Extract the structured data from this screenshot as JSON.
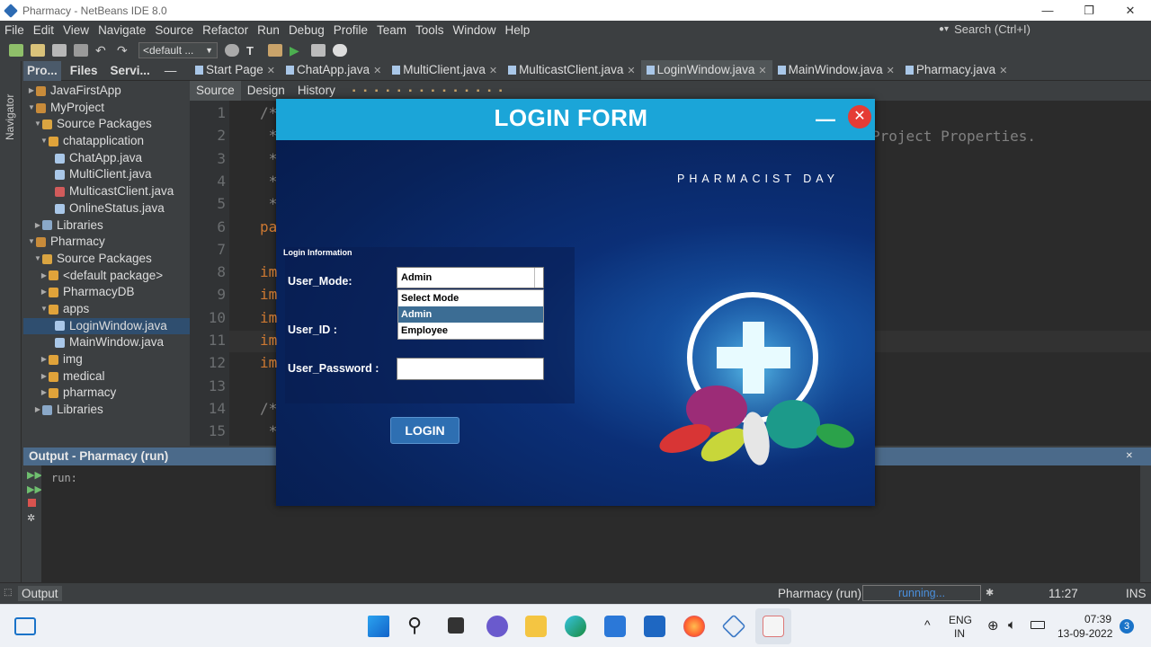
{
  "window": {
    "title": "Pharmacy - NetBeans IDE 8.0",
    "controls": [
      "—",
      "❐",
      "✕"
    ]
  },
  "menu": [
    "File",
    "Edit",
    "View",
    "Navigate",
    "Source",
    "Refactor",
    "Run",
    "Debug",
    "Profile",
    "Team",
    "Tools",
    "Window",
    "Help"
  ],
  "search": {
    "placeholder": "Search (Ctrl+I)"
  },
  "toolbar": {
    "config": "<default ..."
  },
  "navigator": {
    "label": "Navigator"
  },
  "project_panel": {
    "tabs": [
      "Pro...",
      "Files",
      "Servi..."
    ],
    "close": "—",
    "tree": [
      {
        "label": "JavaFirstApp",
        "indent": 0,
        "arrow": "▶",
        "icon": "#c88b3a"
      },
      {
        "label": "MyProject",
        "indent": 0,
        "arrow": "▼",
        "icon": "#c88b3a"
      },
      {
        "label": "Source Packages",
        "indent": 1,
        "arrow": "▼",
        "icon": "#d9a441"
      },
      {
        "label": "chatapplication",
        "indent": 2,
        "arrow": "▼",
        "icon": "#e0a33a"
      },
      {
        "label": "ChatApp.java",
        "indent": 3,
        "arrow": "",
        "icon": "#a9c7e8"
      },
      {
        "label": "MultiClient.java",
        "indent": 3,
        "arrow": "",
        "icon": "#a9c7e8"
      },
      {
        "label": "MulticastClient.java",
        "indent": 3,
        "arrow": "",
        "icon": "#d15b5b"
      },
      {
        "label": "OnlineStatus.java",
        "indent": 3,
        "arrow": "",
        "icon": "#a9c7e8"
      },
      {
        "label": "Libraries",
        "indent": 1,
        "arrow": "▶",
        "icon": "#8aa8c8"
      },
      {
        "label": "Pharmacy",
        "indent": 0,
        "arrow": "▼",
        "icon": "#c88b3a"
      },
      {
        "label": "Source Packages",
        "indent": 1,
        "arrow": "▼",
        "icon": "#d9a441"
      },
      {
        "label": "<default package>",
        "indent": 2,
        "arrow": "▶",
        "icon": "#e0a33a"
      },
      {
        "label": "PharmacyDB",
        "indent": 2,
        "arrow": "▶",
        "icon": "#e0a33a"
      },
      {
        "label": "apps",
        "indent": 2,
        "arrow": "▼",
        "icon": "#e0a33a"
      },
      {
        "label": "LoginWindow.java",
        "indent": 3,
        "arrow": "",
        "icon": "#a9c7e8",
        "selected": true
      },
      {
        "label": "MainWindow.java",
        "indent": 3,
        "arrow": "",
        "icon": "#a9c7e8"
      },
      {
        "label": "img",
        "indent": 2,
        "arrow": "▶",
        "icon": "#e0a33a"
      },
      {
        "label": "medical",
        "indent": 2,
        "arrow": "▶",
        "icon": "#e0a33a"
      },
      {
        "label": "pharmacy",
        "indent": 2,
        "arrow": "▶",
        "icon": "#e0a33a"
      },
      {
        "label": "Libraries",
        "indent": 1,
        "arrow": "▶",
        "icon": "#8aa8c8"
      }
    ]
  },
  "editor_tabs": [
    {
      "label": "Start Page",
      "close": "✕",
      "active": false
    },
    {
      "label": "ChatApp.java",
      "close": "✕",
      "active": false
    },
    {
      "label": "MultiClient.java",
      "close": "✕",
      "active": false
    },
    {
      "label": "MulticastClient.java",
      "close": "✕",
      "active": false
    },
    {
      "label": "LoginWindow.java",
      "close": "✕",
      "active": true
    },
    {
      "label": "MainWindow.java",
      "close": "✕",
      "active": false
    },
    {
      "label": "Pharmacy.java",
      "close": "✕",
      "active": false
    }
  ],
  "editor_subtabs": [
    "Source",
    "Design",
    "History"
  ],
  "code_lines": [
    {
      "no": "1",
      "text": "/*"
    },
    {
      "no": "2",
      "text": " *"
    },
    {
      "no": "3",
      "text": " *"
    },
    {
      "no": "4",
      "text": " *"
    },
    {
      "no": "5",
      "text": " *"
    },
    {
      "no": "6",
      "text": "pa"
    },
    {
      "no": "7",
      "text": ""
    },
    {
      "no": "8",
      "text": "im"
    },
    {
      "no": "9",
      "text": "im"
    },
    {
      "no": "10",
      "text": "im"
    },
    {
      "no": "11",
      "text": "im"
    },
    {
      "no": "12",
      "text": "im"
    },
    {
      "no": "13",
      "text": ""
    },
    {
      "no": "14",
      "text": "/*"
    },
    {
      "no": "15",
      "text": " *"
    }
  ],
  "code_fragment": "Project Properties.",
  "output": {
    "header": "Output - Pharmacy (run)",
    "text": "run:",
    "close": "✕"
  },
  "status": {
    "output_tab": "Output",
    "run_label": "Pharmacy (run)",
    "progress": "running...",
    "position": "11:27",
    "mode": "INS"
  },
  "taskbar": {
    "lang": "ENG",
    "region": "IN",
    "time": "07:39",
    "date": "13-09-2022",
    "badge": "3",
    "tray_chevron": "^"
  },
  "login_dialog": {
    "title": "LOGIN FORM",
    "minimize": "—",
    "close": "✕",
    "tagline": "PHARMACIST DAY",
    "panel_label": "Login Information",
    "user_mode_label": "User_Mode:",
    "user_mode_value": "Admin",
    "options": [
      "Select Mode",
      "Admin",
      "Employee"
    ],
    "selected_option": "Admin",
    "user_id_label": "User_ID :",
    "password_label": "User_Password :",
    "password_value": "",
    "login_button": "LOGIN"
  }
}
